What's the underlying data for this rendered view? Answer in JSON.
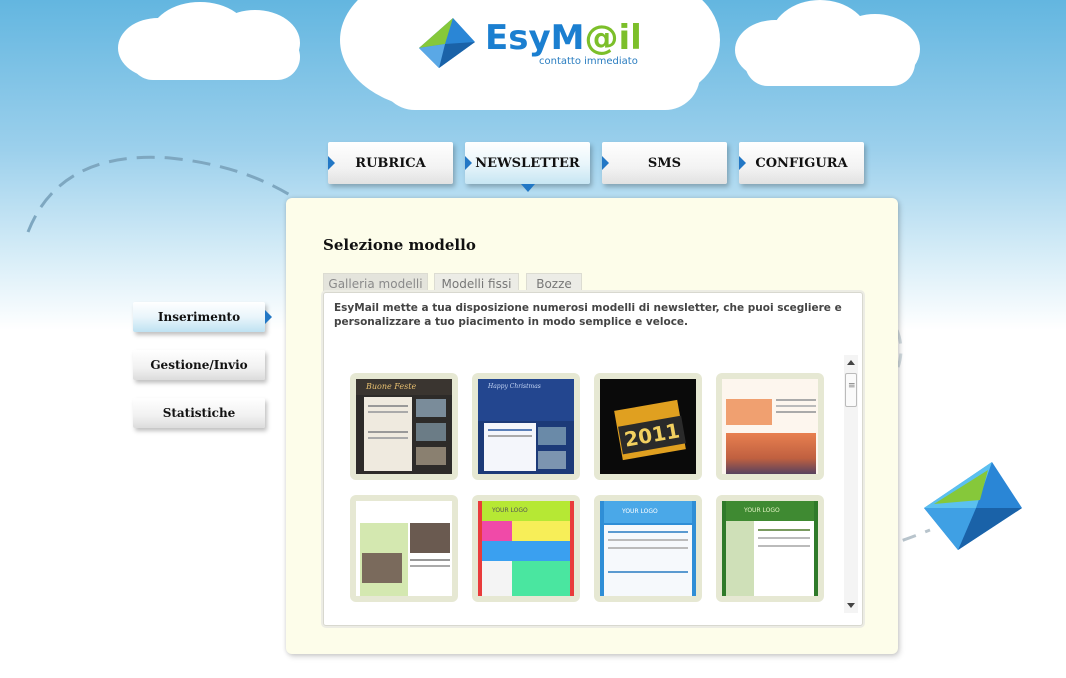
{
  "brand": {
    "name_part1": "EsyM",
    "name_at": "@",
    "name_part2": "il",
    "tagline": "contatto immediato"
  },
  "nav": {
    "tabs": [
      {
        "label": "RUBRICA"
      },
      {
        "label": "NEWSLETTER"
      },
      {
        "label": "SMS"
      },
      {
        "label": "CONFIGURA"
      }
    ],
    "active": "NEWSLETTER"
  },
  "sidebar": {
    "items": [
      {
        "label": "Inserimento"
      },
      {
        "label": "Gestione/Invio"
      },
      {
        "label": "Statistiche"
      }
    ],
    "active": "Inserimento"
  },
  "main": {
    "title": "Selezione modello",
    "subtabs": [
      {
        "label": "Galleria modelli"
      },
      {
        "label": "Modelli fissi"
      },
      {
        "label": "Bozze"
      }
    ],
    "description": "EsyMail mette a tua disposizione numerosi modelli di newsletter, che puoi scegliere e personalizzare a tuo piacimento in modo semplice e veloce.",
    "template_texts": {
      "t1_header": "Buone Feste",
      "t2_header": "Happy Christmas",
      "t3_year": "2011",
      "t6_logo": "YOUR LOGO",
      "t7_logo": "YOUR LOGO",
      "t8_logo": "YOUR LOGO"
    }
  },
  "colors": {
    "accent_blue": "#2277c5",
    "panel_bg": "#fdfdea",
    "thumb_frame": "#e6e8d3",
    "logo_blue": "#1b7fd0",
    "logo_green": "#7cbf2a"
  },
  "icons": [
    "envelope-logo-icon",
    "envelope-decoration-icon",
    "scroll-up-icon",
    "scroll-down-icon"
  ]
}
